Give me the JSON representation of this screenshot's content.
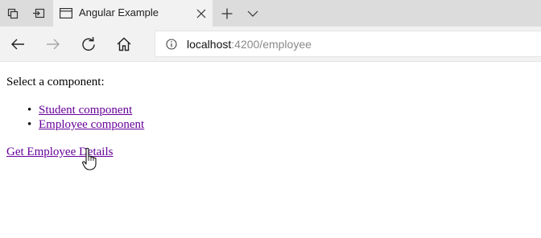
{
  "browser": {
    "tab": {
      "title": "Angular Example",
      "favicon": "page-icon"
    },
    "toolbar_icons": [
      "tab-actions-icon",
      "set-aside-tabs-icon",
      "new-tab-icon",
      "tab-list-chevron-icon"
    ],
    "nav_icons": [
      "back-icon",
      "forward-icon",
      "refresh-icon",
      "home-icon",
      "site-info-icon"
    ],
    "address": {
      "host": "localhost",
      "rest": ":4200/employee"
    }
  },
  "page": {
    "prompt": "Select a component:",
    "components": [
      {
        "label": "Student component"
      },
      {
        "label": "Employee component"
      }
    ],
    "details_link": "Get Employee Details",
    "cursor": "hand-pointer-icon"
  },
  "colors": {
    "tabstrip": "#dcdcdc",
    "toolbar": "#f2f2f2",
    "link": "#660099"
  }
}
